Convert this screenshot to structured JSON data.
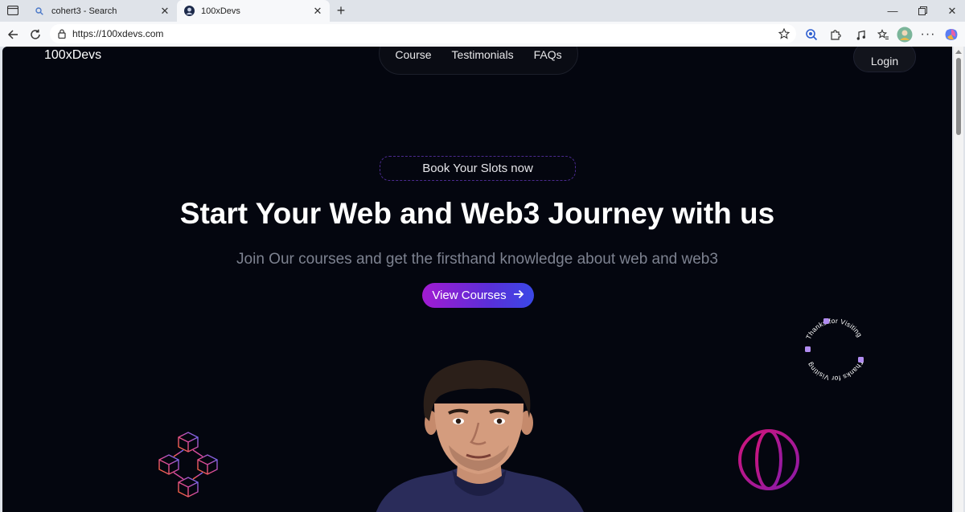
{
  "browser": {
    "tabs": [
      {
        "title": "cohert3 - Search",
        "active": false
      },
      {
        "title": "100xDevs",
        "active": true
      }
    ],
    "url": "https://100xdevs.com"
  },
  "site": {
    "logo": "100xDevs",
    "nav": [
      "Course",
      "Testimonials",
      "FAQs"
    ],
    "login": "Login",
    "slots_pill": "Book Your Slots now",
    "hero_title": "Start Your Web and Web3 Journey with us",
    "hero_subtitle": "Join Our courses and get the firsthand knowledge about web and web3",
    "cta": "View Courses",
    "badge_text": "Thanks for Visiting"
  },
  "colors": {
    "page_bg": "#04060f",
    "cta_start": "#a21bd1",
    "cta_end": "#3a48e6",
    "globe": "#c0127a"
  }
}
